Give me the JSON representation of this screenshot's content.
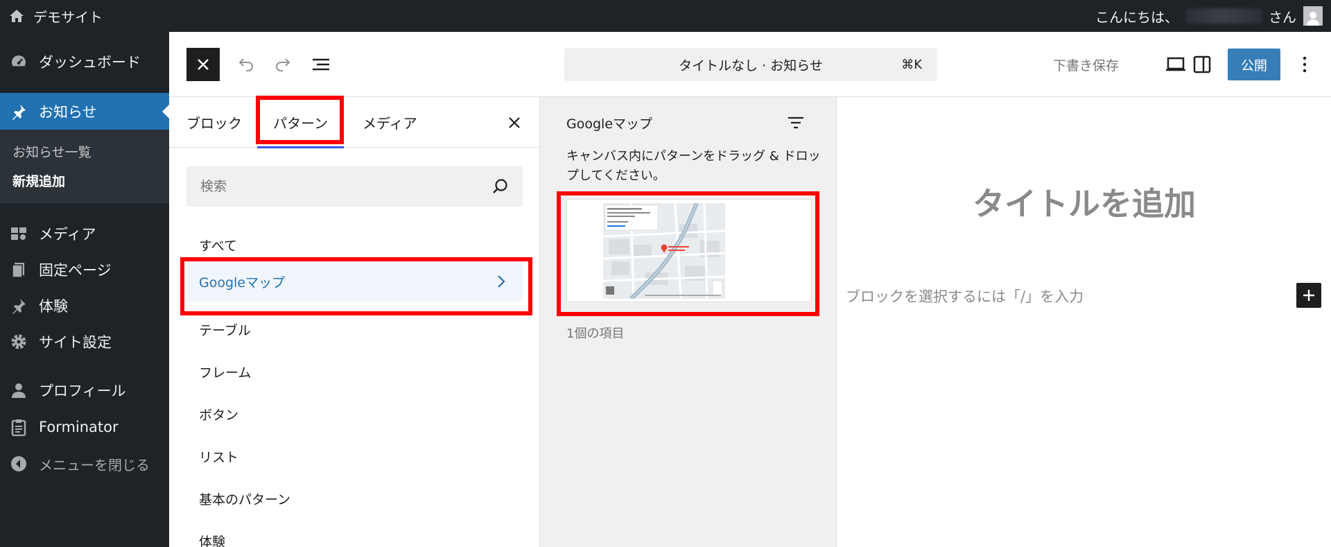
{
  "admin_bar": {
    "site_name": "デモサイト",
    "greeting": "こんにちは、",
    "greeting_suffix": "さん"
  },
  "sidebar": {
    "items": [
      {
        "label": "ダッシュボード",
        "icon": "dashboard-icon"
      },
      {
        "label": "お知らせ",
        "icon": "pin-icon",
        "current": true
      },
      {
        "label": "メディア",
        "icon": "media-icon"
      },
      {
        "label": "固定ページ",
        "icon": "page-icon"
      },
      {
        "label": "体験",
        "icon": "pin-icon"
      },
      {
        "label": "サイト設定",
        "icon": "gear-icon"
      },
      {
        "label": "プロフィール",
        "icon": "user-icon"
      },
      {
        "label": "Forminator",
        "icon": "clipboard-icon"
      },
      {
        "label": "メニューを閉じる",
        "icon": "collapse-icon"
      }
    ],
    "submenu": [
      "お知らせ一覧",
      "新規追加"
    ]
  },
  "header": {
    "document_title": "タイトルなし · お知らせ",
    "shortcut": "⌘K",
    "save_draft": "下書き保存",
    "publish": "公開"
  },
  "inserter": {
    "tabs": [
      "ブロック",
      "パターン",
      "メディア"
    ],
    "active_tab": "パターン",
    "search_placeholder": "検索",
    "categories": [
      "すべて",
      "Googleマップ",
      "テーブル",
      "フレーム",
      "ボタン",
      "リスト",
      "基本のパターン",
      "体験"
    ],
    "active_category": "Googleマップ"
  },
  "patterns": {
    "title": "Googleマップ",
    "description": "キャンバス内にパターンをドラッグ & ドロップしてください。",
    "count": "1個の項目"
  },
  "canvas": {
    "title_placeholder": "タイトルを追加",
    "block_placeholder": "ブロックを選択するには「/」を入力"
  },
  "colors": {
    "admin_dark": "#1d2327",
    "accent": "#2271b1",
    "highlight": "#ff0000"
  }
}
